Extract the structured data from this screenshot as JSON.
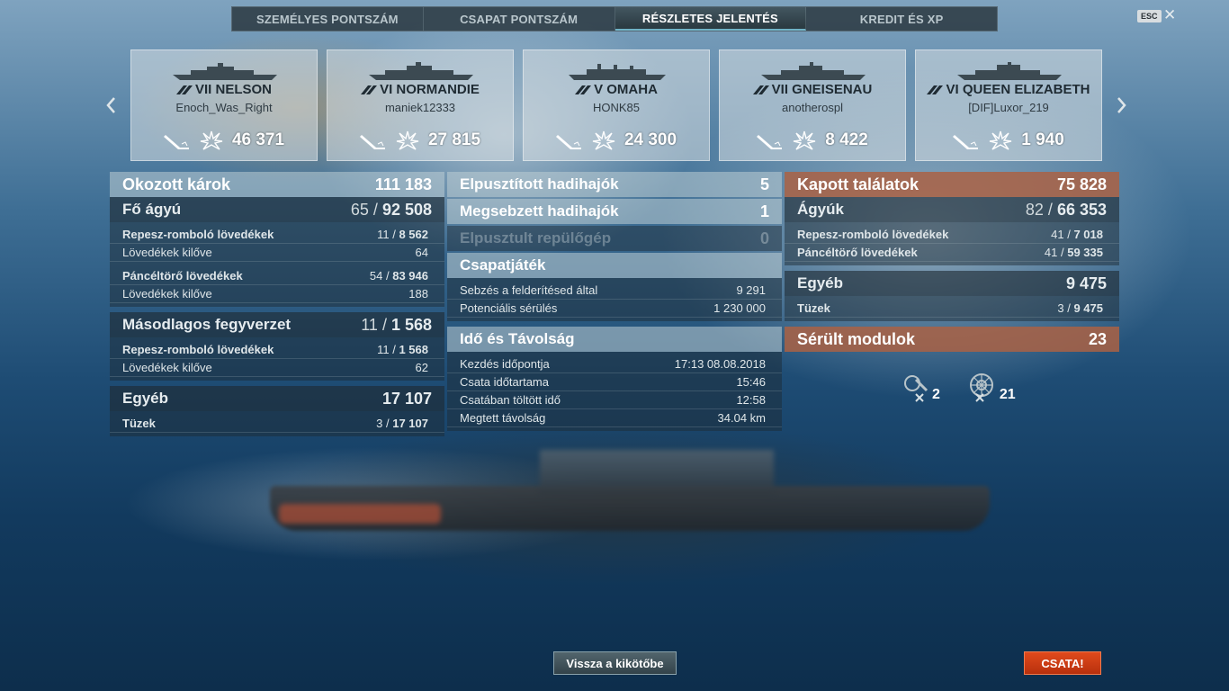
{
  "tabs": [
    {
      "label": "SZEMÉLYES PONTSZÁM",
      "active": false
    },
    {
      "label": "CSAPAT PONTSZÁM",
      "active": false
    },
    {
      "label": "RÉSZLETES JELENTÉS",
      "active": true
    },
    {
      "label": "KREDIT ÉS XP",
      "active": false
    }
  ],
  "esc_label": "ESC",
  "cards": [
    {
      "ship": "VII NELSON",
      "player": "Enoch_Was_Right",
      "damage": "46 371"
    },
    {
      "ship": "VI NORMANDIE",
      "player": "maniek12333",
      "damage": "27 815"
    },
    {
      "ship": "V OMAHA",
      "player": "HONK85",
      "damage": "24 300"
    },
    {
      "ship": "VII GNEISENAU",
      "player": "anotherospl",
      "damage": "8 422"
    },
    {
      "ship": "VI QUEEN ELIZABETH",
      "player": "[DIF]Luxor_219",
      "damage": "1 940"
    }
  ],
  "left": {
    "title": "Okozott károk",
    "title_value": "111 183",
    "main": {
      "label": "Fő ágyú",
      "hits": "65",
      "value": "92 508"
    },
    "main_rows": [
      {
        "label": "Repesz-romboló lövedékek",
        "hits": "11",
        "value": "8 562"
      },
      {
        "label": "Lövedékek kilőve",
        "value": "64"
      },
      {
        "label": "Páncéltörő lövedékek",
        "hits": "54",
        "value": "83 946"
      },
      {
        "label": "Lövedékek kilőve",
        "value": "188"
      }
    ],
    "secondary": {
      "label": "Másodlagos fegyverzet",
      "hits": "11",
      "value": "1 568"
    },
    "secondary_rows": [
      {
        "label": "Repesz-romboló lövedékek",
        "hits": "11",
        "value": "1 568"
      },
      {
        "label": "Lövedékek kilőve",
        "value": "62"
      }
    ],
    "other": {
      "label": "Egyéb",
      "value": "17 107"
    },
    "other_rows": [
      {
        "label": "Tüzek",
        "hits": "3",
        "value": "17 107"
      }
    ]
  },
  "middle": {
    "destroyed_ships": {
      "label": "Elpusztított hadihajók",
      "value": "5"
    },
    "damaged_ships": {
      "label": "Megsebzett hadihajók",
      "value": "1"
    },
    "destroyed_planes": {
      "label": "Elpusztult repülőgép",
      "value": "0"
    },
    "teamplay": {
      "label": "Csapatjáték"
    },
    "teamplay_rows": [
      {
        "label": "Sebzés a felderítésed által",
        "value": "9 291"
      },
      {
        "label": "Potenciális sérülés",
        "value": "1 230 000"
      }
    ],
    "time": {
      "label": "Idő és Távolság"
    },
    "time_rows": [
      {
        "label": "Kezdés időpontja",
        "value": "17:13  08.08.2018"
      },
      {
        "label": "Csata időtartama",
        "value": "15:46"
      },
      {
        "label": "Csatában töltött idő",
        "value": "12:58"
      },
      {
        "label": "Megtett távolság",
        "value": "34.04 km"
      }
    ]
  },
  "right": {
    "title": "Kapott találatok",
    "title_value": "75 828",
    "guns": {
      "label": "Ágyúk",
      "hits": "82",
      "value": "66 353"
    },
    "gun_rows": [
      {
        "label": "Repesz-romboló lövedékek",
        "hits": "41",
        "value": "7 018"
      },
      {
        "label": "Páncéltörő lövedékek",
        "hits": "41",
        "value": "59 335"
      }
    ],
    "other": {
      "label": "Egyéb",
      "value": "9 475"
    },
    "other_rows": [
      {
        "label": "Tüzek",
        "hits": "3",
        "value": "9 475"
      }
    ],
    "modules": {
      "label": "Sérült modulok",
      "value": "23"
    },
    "module_counts": {
      "gun": "2",
      "engine": "21"
    }
  },
  "buttons": {
    "back": "Vissza a kikötőbe",
    "battle": "CSATA!"
  },
  "colors": {
    "accent_orange": "#b8300d",
    "header_orange": "#aa6244",
    "active_tab_underline": "#6fb3c7"
  }
}
